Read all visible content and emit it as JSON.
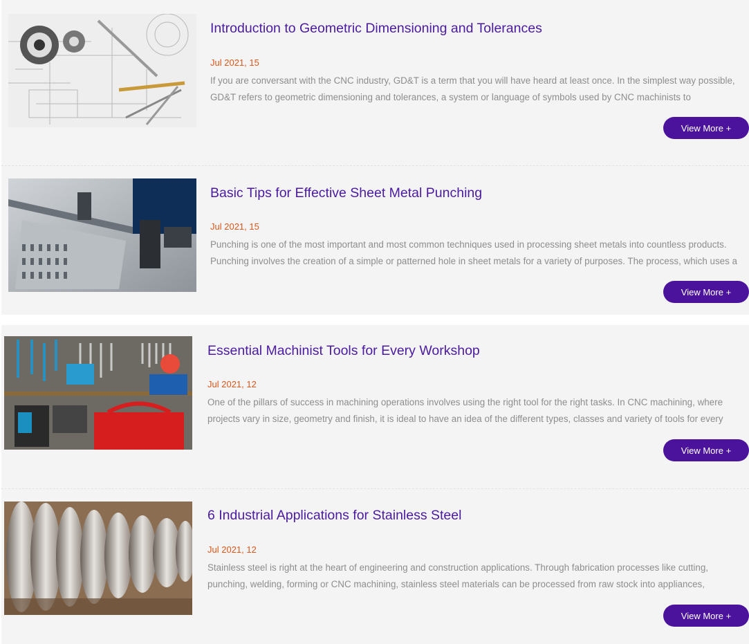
{
  "articles": [
    {
      "title": "Introduction to Geometric Dimensioning and Tolerances",
      "date": "Jul 2021, 15",
      "excerpt": "If you are conversant with the CNC industry, GD&T is a term that you will have heard at least once. In the simplest way possible, GD&T refers to geometric dimensioning and tolerances, a system or language of symbols used by CNC machinists to",
      "button_label": "View More +",
      "image_icon": "technical-drawing-image"
    },
    {
      "title": "Basic Tips for Effective Sheet Metal Punching",
      "date": "Jul 2021, 15",
      "excerpt": "Punching is one of the most important and most common techniques used in processing sheet metals into countless products. Punching involves the creation of a simple or patterned hole in sheet metals for a variety of purposes. The process, which uses a",
      "button_label": "View More +",
      "image_icon": "sheet-metal-punching-image"
    },
    {
      "title": "Essential Machinist Tools for Every Workshop",
      "date": "Jul 2021, 12",
      "excerpt": "One of the pillars of success in machining operations involves using the right tool for the right tasks. In CNC machining, where projects vary in size, geometry and finish, it is ideal to have an idea of the different types, classes and variety of tools for every",
      "button_label": "View More +",
      "image_icon": "tool-wall-image"
    },
    {
      "title": "6 Industrial Applications for Stainless Steel",
      "date": "Jul 2021, 12",
      "excerpt": "Stainless steel is right at the heart of engineering and construction applications. Through fabrication processes like cutting, punching, welding, forming or CNC machining, stainless steel materials can be processed from raw stock into appliances,",
      "button_label": "View More +",
      "image_icon": "stainless-steel-coils-image"
    }
  ],
  "colors": {
    "title": "#4a1aa0",
    "date": "#d9571a",
    "excerpt": "#8d8d8d",
    "button_bg": "#4b139c",
    "card_bg": "#f4f4f4"
  }
}
